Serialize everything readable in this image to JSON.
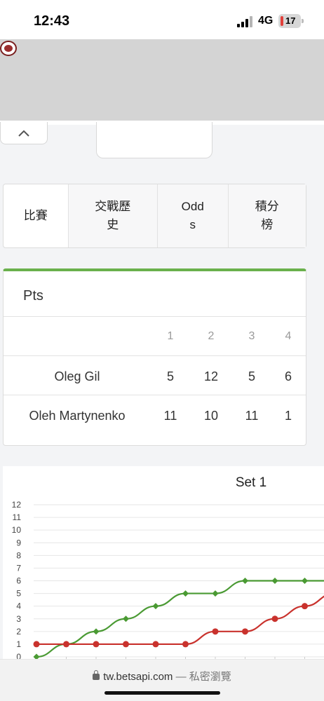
{
  "status_bar": {
    "time": "12:43",
    "network": "4G",
    "battery": "17"
  },
  "tabs": [
    {
      "label": "比賽"
    },
    {
      "label": "交戰歷史"
    },
    {
      "label": "Odds"
    },
    {
      "label": "積分榜"
    }
  ],
  "score_table": {
    "title": "Pts",
    "columns": [
      "1",
      "2",
      "3",
      "4"
    ],
    "rows": [
      {
        "player": "Oleg Gil",
        "scores": [
          "5",
          "12",
          "5",
          "6"
        ]
      },
      {
        "player": "Oleh Martynenko",
        "scores": [
          "11",
          "10",
          "11",
          "1"
        ]
      }
    ]
  },
  "chart_data": {
    "type": "line",
    "title": "Set 1",
    "y_ticks": [
      "0",
      "1",
      "2",
      "3",
      "4",
      "5",
      "6",
      "7",
      "8",
      "9",
      "10",
      "11",
      "12"
    ],
    "ylim": [
      0,
      12
    ],
    "grid": true,
    "series": [
      {
        "color": "#4a9a33",
        "marker": "diamond",
        "values": [
          0,
          1,
          2,
          3,
          4,
          5,
          5,
          6,
          6,
          6,
          6
        ]
      },
      {
        "color": "#c9322d",
        "marker": "circle",
        "values": [
          1,
          1,
          1,
          1,
          1,
          1,
          2,
          2,
          3,
          4,
          5
        ]
      }
    ]
  },
  "footer": {
    "domain": "tw.betsapi.com",
    "separator": "—",
    "mode": "私密瀏覽"
  },
  "colors": {
    "accent_green": "#6ab04c",
    "series_green": "#4a9a33",
    "series_red": "#c9322d"
  }
}
